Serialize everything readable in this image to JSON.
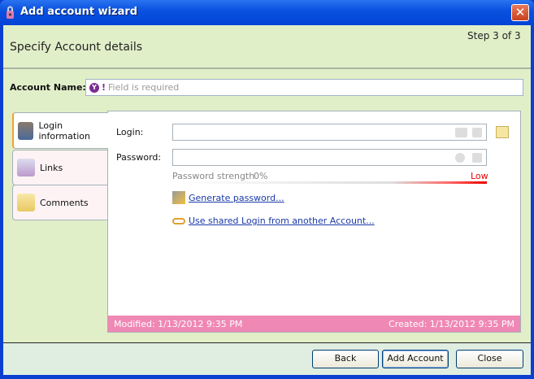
{
  "window": {
    "title": "Add account wizard",
    "close": "✕"
  },
  "header": {
    "step": "Step 3 of 3",
    "heading": "Specify Account details"
  },
  "account_name": {
    "label": "Account Name:",
    "badge": "Y",
    "badge_mark": "!",
    "placeholder": "Field is required"
  },
  "tabs": [
    {
      "label": "Login information"
    },
    {
      "label": "Links"
    },
    {
      "label": "Comments"
    }
  ],
  "login": {
    "login_label": "Login:",
    "password_label": "Password:",
    "strength_label": "Password strength",
    "strength_value": "0%",
    "strength_level": "Low",
    "strength_fraction": 0,
    "generate": "Generate password...",
    "shared": "Use shared Login from another Account..."
  },
  "footer": {
    "modified": "Modified: 1/13/2012 9:35 PM",
    "created": "Created: 1/13/2012 9:35 PM"
  },
  "buttons": {
    "back": "Back",
    "add": "Add Account",
    "close": "Close"
  }
}
